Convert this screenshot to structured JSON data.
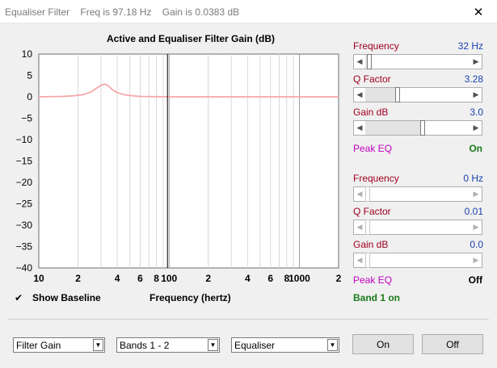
{
  "window": {
    "title": "Equaliser Filter    Freq is 97.18 Hz    Gain is 0.0383 dB",
    "close_glyph": "✕"
  },
  "chart_data": {
    "type": "line",
    "title": "Active and Equaliser Filter Gain (dB)",
    "xlabel": "Frequency (hertz)",
    "ylabel": "",
    "x_scale": "log",
    "xlim": [
      10,
      2000
    ],
    "ylim": [
      -40,
      10
    ],
    "y_ticks": [
      "10",
      "5",
      "0",
      "−5",
      "−10",
      "−15",
      "−20",
      "−25",
      "−30",
      "−35",
      "−40"
    ],
    "x_tick_labels": [
      {
        "value": 10,
        "label": "10"
      },
      {
        "value": 20,
        "label": "2"
      },
      {
        "value": 40,
        "label": "4"
      },
      {
        "value": 60,
        "label": "6"
      },
      {
        "value": 80,
        "label": "8"
      },
      {
        "value": 100,
        "label": "100"
      },
      {
        "value": 200,
        "label": "2"
      },
      {
        "value": 400,
        "label": "4"
      },
      {
        "value": 600,
        "label": "6"
      },
      {
        "value": 800,
        "label": "8"
      },
      {
        "value": 1000,
        "label": "1000"
      },
      {
        "value": 2000,
        "label": "2"
      }
    ],
    "cursor_x": 97.18,
    "grid": true,
    "series": [
      {
        "color": "#f4a7a7",
        "x": [
          10,
          15,
          18,
          22,
          25,
          28,
          30,
          32,
          34,
          37,
          40,
          45,
          50,
          60,
          100,
          200,
          2000
        ],
        "y": [
          0,
          0.1,
          0.2,
          0.5,
          1.1,
          2.1,
          2.7,
          3.0,
          2.6,
          1.6,
          1.0,
          0.5,
          0.3,
          0.1,
          0,
          0,
          0
        ]
      }
    ]
  },
  "band1": {
    "frequency": {
      "label": "Frequency",
      "value": "32 Hz",
      "fraction": 0.02
    },
    "q": {
      "label": "Q Factor",
      "value": "3.28",
      "fraction": 0.3
    },
    "gain": {
      "label": "Gain  dB",
      "value": "3.0",
      "fraction": 0.55
    },
    "mode": {
      "label": "Peak EQ",
      "state": "On",
      "state_color": "#1a7a1a"
    }
  },
  "band2": {
    "frequency": {
      "label": "Frequency",
      "value": "0 Hz",
      "fraction": 0.0
    },
    "q": {
      "label": "Q Factor",
      "value": "0.01",
      "fraction": 0.0
    },
    "gain": {
      "label": "Gain  dB",
      "value": "0.0",
      "fraction": 0.0
    },
    "mode": {
      "label": "Peak EQ",
      "state": "Off",
      "state_color": "#000000"
    }
  },
  "options": {
    "check_glyph": "✔",
    "show_baseline": "Show Baseline",
    "band_status": "Band 1 on"
  },
  "bottom": {
    "view_combo": "Filter Gain",
    "bands_combo": "Bands 1 - 2",
    "type_combo": "Equaliser",
    "combo_arrow": "▼",
    "on_button": "On",
    "off_button": "Off"
  },
  "icons": {
    "left_arrow": "◀",
    "right_arrow": "▶"
  }
}
